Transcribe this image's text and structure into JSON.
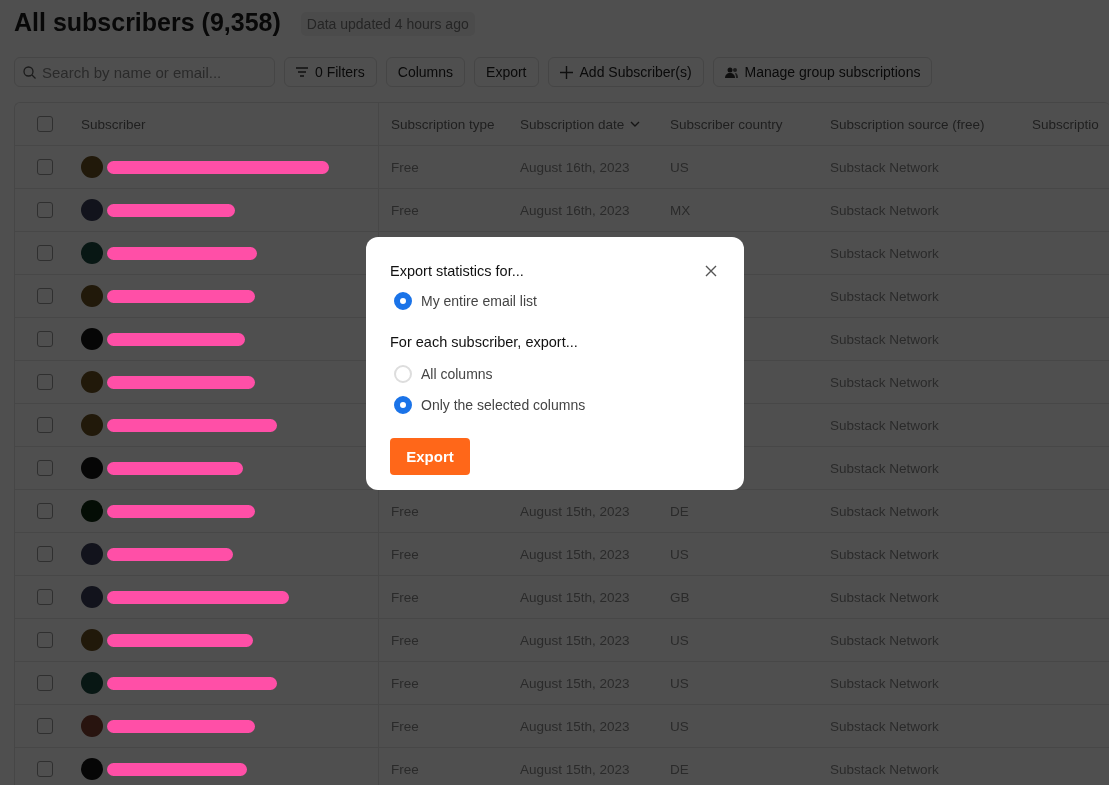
{
  "header": {
    "title": "All subscribers (9,358)",
    "updated_badge": "Data updated 4 hours ago"
  },
  "toolbar": {
    "search": {
      "placeholder": "Search by name or email..."
    },
    "buttons": [
      {
        "kind": "filter",
        "label": "0 Filters"
      },
      {
        "kind": "plain",
        "label": "Columns"
      },
      {
        "kind": "plain",
        "label": "Export"
      },
      {
        "kind": "add",
        "label": "Add Subscriber(s)"
      },
      {
        "kind": "group",
        "label": "Manage group subscriptions"
      }
    ]
  },
  "table": {
    "select_all": {
      "checked": false
    },
    "columns": [
      {
        "label": "Subscriber",
        "sorted": false
      },
      {
        "label": "Subscription type",
        "sorted": false
      },
      {
        "label": "Subscription date",
        "sorted": true
      },
      {
        "label": "Subscriber country",
        "sorted": false
      },
      {
        "label": "Subscription source (free)",
        "sorted": false
      },
      {
        "label": "Subscriptio",
        "sorted": false
      }
    ],
    "rows": [
      {
        "checked": false,
        "type": "Free",
        "date": "August 16th, 2023",
        "country": "US",
        "source": "Substack Network"
      },
      {
        "checked": false,
        "type": "Free",
        "date": "August 16th, 2023",
        "country": "MX",
        "source": "Substack Network"
      },
      {
        "checked": false,
        "source": "Substack Network"
      },
      {
        "checked": false,
        "source": "Substack Network"
      },
      {
        "checked": false,
        "source": "Substack Network"
      },
      {
        "checked": false,
        "source": "Substack Network"
      },
      {
        "checked": false,
        "source": "Substack Network"
      },
      {
        "checked": false,
        "source": "Substack Network"
      },
      {
        "checked": false,
        "type": "Free",
        "date": "August 15th, 2023",
        "country": "DE",
        "source": "Substack Network"
      },
      {
        "checked": false,
        "type": "Free",
        "date": "August 15th, 2023",
        "country": "US",
        "source": "Substack Network"
      },
      {
        "checked": false,
        "type": "Free",
        "date": "August 15th, 2023",
        "country": "GB",
        "source": "Substack Network"
      },
      {
        "checked": false,
        "type": "Free",
        "date": "August 15th, 2023",
        "country": "US",
        "source": "Substack Network"
      },
      {
        "checked": false,
        "type": "Free",
        "date": "August 15th, 2023",
        "country": "US",
        "source": "Substack Network"
      },
      {
        "checked": false,
        "type": "Free",
        "date": "August 15th, 2023",
        "country": "US",
        "source": "Substack Network"
      },
      {
        "checked": false,
        "type": "Free",
        "date": "August 15th, 2023",
        "country": "DE",
        "source": "Substack Network"
      }
    ]
  },
  "export_dialog": {
    "groups": [
      {
        "heading": "Export statistics for...",
        "options": [
          {
            "label": "My entire email list",
            "selected": true
          }
        ]
      },
      {
        "heading": "For each subscriber, export...",
        "options": [
          {
            "label": "All columns",
            "selected": false
          },
          {
            "label": "Only the selected columns",
            "selected": true
          }
        ]
      }
    ],
    "button": "Export"
  }
}
